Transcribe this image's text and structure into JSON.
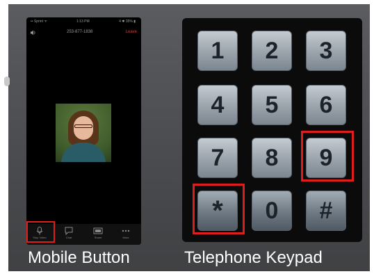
{
  "phone": {
    "status": {
      "carrier": "•• Sprint ᯤ",
      "time": "1:13 PM",
      "battery": "4 ✱ 35% ▮"
    },
    "call_bar": {
      "number": "253-877-1838",
      "leave": "Leave"
    },
    "toolbar": [
      {
        "label": "Stop Video",
        "icon": "camera-icon"
      },
      {
        "label": "Chat",
        "icon": "chat-icon"
      },
      {
        "label": "Share",
        "icon": "share-icon"
      },
      {
        "label": "More",
        "icon": "more-icon"
      }
    ]
  },
  "keypad": {
    "keys": [
      "1",
      "2",
      "3",
      "4",
      "5",
      "6",
      "7",
      "8",
      "9",
      "*",
      "0",
      "#"
    ],
    "highlighted": [
      "9",
      "*"
    ]
  },
  "captions": {
    "mobile": "Mobile Button",
    "keypad": "Telephone Keypad"
  },
  "colors": {
    "highlight": "#e01d1d",
    "leave": "#d53a3a",
    "background": "#4a4c4f"
  }
}
